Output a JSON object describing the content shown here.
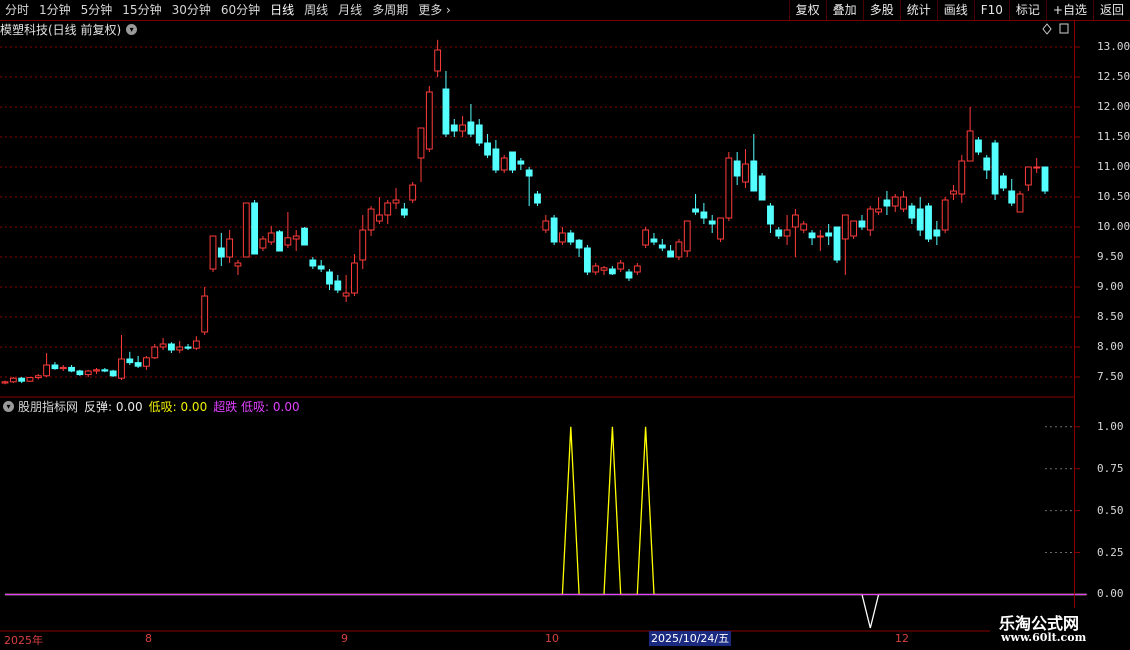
{
  "toolbar": {
    "periods": [
      "分时",
      "1分钟",
      "5分钟",
      "15分钟",
      "30分钟",
      "60分钟",
      "日线",
      "周线",
      "月线",
      "多周期",
      "更多"
    ],
    "active_period": "日线",
    "buttons": [
      "复权",
      "叠加",
      "多股",
      "统计",
      "画线",
      "F10",
      "标记",
      "+自选",
      "返回"
    ]
  },
  "stock": {
    "title": "模塑科技(日线 前复权)"
  },
  "indicator": {
    "name": "股朋指标网",
    "s1_label": "反弹:",
    "s1_value": "0.00",
    "s2_label": "低吸:",
    "s2_value": "0.00",
    "s3_label": "超跌 低吸:",
    "s3_value": "0.00"
  },
  "colors": {
    "up": "#ff3c3c",
    "down": "#54ffff",
    "grid": "#8a0000",
    "s1": "#ffffff",
    "s2": "#ffff00",
    "s3": "#e040ff"
  },
  "dates": {
    "year": "2025年",
    "m8": "8",
    "m9": "9",
    "m10": "10",
    "m12": "12",
    "selected": "2025/10/24/五"
  },
  "watermark": {
    "line1": "乐淘公式网",
    "line2": "www.60lt.com"
  },
  "chart_data": [
    {
      "type": "candlestick",
      "title": "",
      "ylim": [
        7.2,
        13.2
      ],
      "yticks": [
        "13.00",
        "12.50",
        "12.00",
        "11.50",
        "11.00",
        "10.50",
        "10.00",
        "9.50",
        "9.00",
        "8.50",
        "8.00",
        "7.50"
      ],
      "tickvalues": [
        13.0,
        12.5,
        12.0,
        11.5,
        11.0,
        10.5,
        10.0,
        9.5,
        9.0,
        8.5,
        8.0,
        7.5
      ],
      "ohlc": [
        [
          7.4,
          7.44,
          7.38,
          7.42
        ],
        [
          7.42,
          7.5,
          7.4,
          7.48
        ],
        [
          7.48,
          7.5,
          7.4,
          7.43
        ],
        [
          7.43,
          7.5,
          7.42,
          7.49
        ],
        [
          7.49,
          7.55,
          7.46,
          7.52
        ],
        [
          7.52,
          7.9,
          7.5,
          7.7
        ],
        [
          7.7,
          7.75,
          7.62,
          7.64
        ],
        [
          7.64,
          7.7,
          7.6,
          7.66
        ],
        [
          7.66,
          7.7,
          7.58,
          7.6
        ],
        [
          7.6,
          7.62,
          7.52,
          7.54
        ],
        [
          7.54,
          7.62,
          7.5,
          7.6
        ],
        [
          7.6,
          7.65,
          7.55,
          7.62
        ],
        [
          7.62,
          7.65,
          7.58,
          7.6
        ],
        [
          7.6,
          7.62,
          7.5,
          7.52
        ],
        [
          7.48,
          8.2,
          7.45,
          7.8
        ],
        [
          7.8,
          7.92,
          7.7,
          7.74
        ],
        [
          7.74,
          7.85,
          7.65,
          7.68
        ],
        [
          7.68,
          7.85,
          7.62,
          7.82
        ],
        [
          7.82,
          8.05,
          7.8,
          8.0
        ],
        [
          8.0,
          8.15,
          7.95,
          8.05
        ],
        [
          8.05,
          8.08,
          7.9,
          7.95
        ],
        [
          7.95,
          8.1,
          7.9,
          8.0
        ],
        [
          8.0,
          8.05,
          7.95,
          7.98
        ],
        [
          7.98,
          8.18,
          7.95,
          8.1
        ],
        [
          8.25,
          9.0,
          8.2,
          8.85
        ],
        [
          9.3,
          9.85,
          9.25,
          9.85
        ],
        [
          9.65,
          9.9,
          9.35,
          9.5
        ],
        [
          9.5,
          9.95,
          9.4,
          9.8
        ],
        [
          9.35,
          9.45,
          9.2,
          9.4
        ],
        [
          9.5,
          10.4,
          9.5,
          10.4
        ],
        [
          10.4,
          10.45,
          9.55,
          9.55
        ],
        [
          9.65,
          9.85,
          9.6,
          9.8
        ],
        [
          9.75,
          10.02,
          9.7,
          9.9
        ],
        [
          9.92,
          9.95,
          9.6,
          9.6
        ],
        [
          9.7,
          10.25,
          9.65,
          9.82
        ],
        [
          9.8,
          9.95,
          9.6,
          9.85
        ],
        [
          9.98,
          10.0,
          9.7,
          9.7
        ],
        [
          9.45,
          9.5,
          9.3,
          9.35
        ],
        [
          9.35,
          9.45,
          9.25,
          9.3
        ],
        [
          9.25,
          9.3,
          8.95,
          9.05
        ],
        [
          9.1,
          9.2,
          8.9,
          8.95
        ],
        [
          8.85,
          9.2,
          8.75,
          8.9
        ],
        [
          8.9,
          9.55,
          8.85,
          9.4
        ],
        [
          9.45,
          10.2,
          9.3,
          9.95
        ],
        [
          9.95,
          10.35,
          9.85,
          10.3
        ],
        [
          10.1,
          10.5,
          10.05,
          10.2
        ],
        [
          10.2,
          10.45,
          10.05,
          10.4
        ],
        [
          10.4,
          10.65,
          10.3,
          10.45
        ],
        [
          10.3,
          10.4,
          10.15,
          10.2
        ],
        [
          10.45,
          10.75,
          10.4,
          10.7
        ],
        [
          11.15,
          11.65,
          10.75,
          11.65
        ],
        [
          11.3,
          12.35,
          11.25,
          12.25
        ],
        [
          12.6,
          13.12,
          12.5,
          12.95
        ],
        [
          12.3,
          12.6,
          11.5,
          11.55
        ],
        [
          11.7,
          11.8,
          11.5,
          11.6
        ],
        [
          11.6,
          11.85,
          11.5,
          11.7
        ],
        [
          11.75,
          12.05,
          11.5,
          11.55
        ],
        [
          11.7,
          11.8,
          11.35,
          11.4
        ],
        [
          11.4,
          11.55,
          11.15,
          11.2
        ],
        [
          11.3,
          11.45,
          10.9,
          10.95
        ],
        [
          10.95,
          11.2,
          10.9,
          11.15
        ],
        [
          11.25,
          11.25,
          10.9,
          10.95
        ],
        [
          11.1,
          11.15,
          10.95,
          11.05
        ],
        [
          10.95,
          11.0,
          10.35,
          10.85
        ],
        [
          10.55,
          10.6,
          10.35,
          10.4
        ],
        [
          9.95,
          10.2,
          9.9,
          10.1
        ],
        [
          10.15,
          10.2,
          9.7,
          9.75
        ],
        [
          9.75,
          10.0,
          9.7,
          9.9
        ],
        [
          9.9,
          9.95,
          9.7,
          9.75
        ],
        [
          9.78,
          9.8,
          9.5,
          9.65
        ],
        [
          9.65,
          9.7,
          9.2,
          9.25
        ],
        [
          9.25,
          9.4,
          9.2,
          9.35
        ],
        [
          9.28,
          9.35,
          9.2,
          9.32
        ],
        [
          9.3,
          9.35,
          9.2,
          9.22
        ],
        [
          9.3,
          9.45,
          9.25,
          9.4
        ],
        [
          9.25,
          9.3,
          9.1,
          9.15
        ],
        [
          9.25,
          9.4,
          9.2,
          9.35
        ],
        [
          9.7,
          10.0,
          9.65,
          9.95
        ],
        [
          9.8,
          9.9,
          9.7,
          9.75
        ],
        [
          9.7,
          9.8,
          9.6,
          9.65
        ],
        [
          9.6,
          9.7,
          9.5,
          9.5
        ],
        [
          9.5,
          9.8,
          9.45,
          9.75
        ],
        [
          9.6,
          10.1,
          9.5,
          10.1
        ],
        [
          10.3,
          10.55,
          10.2,
          10.25
        ],
        [
          10.25,
          10.4,
          10.05,
          10.15
        ],
        [
          10.1,
          10.2,
          9.9,
          10.05
        ],
        [
          9.8,
          10.1,
          9.75,
          10.15
        ],
        [
          10.15,
          11.25,
          10.1,
          11.15
        ],
        [
          11.1,
          11.25,
          10.7,
          10.85
        ],
        [
          10.75,
          11.3,
          10.65,
          11.05
        ],
        [
          11.1,
          11.55,
          10.8,
          10.6
        ],
        [
          10.85,
          10.9,
          10.45,
          10.45
        ],
        [
          10.35,
          10.4,
          9.9,
          10.05
        ],
        [
          9.95,
          10.0,
          9.8,
          9.85
        ],
        [
          9.85,
          10.2,
          9.7,
          9.95
        ],
        [
          10.0,
          10.3,
          9.5,
          10.2
        ],
        [
          9.95,
          10.1,
          9.9,
          10.05
        ],
        [
          9.9,
          9.95,
          9.7,
          9.82
        ],
        [
          9.85,
          9.95,
          9.6,
          9.85
        ],
        [
          9.9,
          10.05,
          9.7,
          9.85
        ],
        [
          10.0,
          10.0,
          9.4,
          9.45
        ],
        [
          9.8,
          9.9,
          9.2,
          10.2
        ],
        [
          9.85,
          10.1,
          9.8,
          10.1
        ],
        [
          10.1,
          10.2,
          9.95,
          10.0
        ],
        [
          9.95,
          10.35,
          9.85,
          10.3
        ],
        [
          10.25,
          10.5,
          10.2,
          10.3
        ],
        [
          10.45,
          10.6,
          10.2,
          10.35
        ],
        [
          10.35,
          10.55,
          10.25,
          10.5
        ],
        [
          10.3,
          10.6,
          10.25,
          10.5
        ],
        [
          10.35,
          10.4,
          10.05,
          10.15
        ],
        [
          10.3,
          10.5,
          9.85,
          9.95
        ],
        [
          10.35,
          10.4,
          9.75,
          9.8
        ],
        [
          9.95,
          10.1,
          9.7,
          9.85
        ],
        [
          9.95,
          10.5,
          9.9,
          10.45
        ],
        [
          10.55,
          10.7,
          10.45,
          10.6
        ],
        [
          10.55,
          11.2,
          10.4,
          11.1
        ],
        [
          11.1,
          12.0,
          11.3,
          11.6
        ],
        [
          11.45,
          11.5,
          11.2,
          11.25
        ],
        [
          11.15,
          11.2,
          10.8,
          10.95
        ],
        [
          11.4,
          11.45,
          10.45,
          10.55
        ],
        [
          10.85,
          10.9,
          10.6,
          10.65
        ],
        [
          10.6,
          10.8,
          10.35,
          10.4
        ],
        [
          10.25,
          10.6,
          10.25,
          10.55
        ],
        [
          10.7,
          10.95,
          10.6,
          11.0
        ],
        [
          11.0,
          11.15,
          10.9,
          11.0
        ],
        [
          11.0,
          11.0,
          10.55,
          10.6
        ]
      ]
    },
    {
      "type": "line",
      "title": "",
      "ylim": [
        -0.2,
        1.1
      ],
      "yticks": [
        "1.00",
        "0.75",
        "0.50",
        "0.25",
        "0.00"
      ],
      "tickvalues": [
        1.0,
        0.75,
        0.5,
        0.25,
        0.0
      ],
      "series": [
        {
          "name": "反弹",
          "values": [
            0,
            0,
            0,
            0,
            0,
            0,
            0,
            0,
            0,
            0,
            0,
            0,
            0,
            0,
            0,
            0,
            0,
            0,
            0,
            0,
            0,
            0,
            0,
            0,
            0,
            0,
            0,
            0,
            0,
            0,
            0,
            0,
            0,
            0,
            0,
            0,
            0,
            0,
            0,
            0,
            0,
            0,
            0,
            0,
            0,
            0,
            0,
            0,
            0,
            0,
            0,
            0,
            0,
            0,
            0,
            0,
            0,
            0,
            0,
            0,
            0,
            0,
            0,
            0,
            0,
            0,
            0,
            0,
            0,
            0,
            0,
            0,
            0,
            0,
            0,
            0,
            0,
            0,
            0,
            0,
            0,
            0,
            0,
            0,
            0,
            0,
            0,
            0,
            0,
            0,
            0,
            0,
            0,
            0,
            0,
            0,
            0,
            0,
            0,
            0,
            0,
            0,
            0,
            0,
            -0.2,
            0,
            0,
            0,
            0,
            0,
            0,
            0,
            0,
            0,
            0,
            0,
            0,
            0,
            0,
            0,
            0,
            0,
            0,
            0,
            0,
            0,
            0,
            0,
            0,
            0,
            0
          ]
        },
        {
          "name": "低吸",
          "values": [
            0,
            0,
            0,
            0,
            0,
            0,
            0,
            0,
            0,
            0,
            0,
            0,
            0,
            0,
            0,
            0,
            0,
            0,
            0,
            0,
            0,
            0,
            0,
            0,
            0,
            0,
            0,
            0,
            0,
            0,
            0,
            0,
            0,
            0,
            0,
            0,
            0,
            0,
            0,
            0,
            0,
            0,
            0,
            0,
            0,
            0,
            0,
            0,
            0,
            0,
            0,
            0,
            0,
            0,
            0,
            0,
            0,
            0,
            0,
            0,
            0,
            0,
            0,
            0,
            0,
            0,
            0,
            0,
            1,
            0,
            0,
            0,
            0,
            1,
            0,
            0,
            0,
            1,
            0,
            0,
            0,
            0,
            0,
            0,
            0,
            0,
            0,
            0,
            0,
            0,
            0,
            0,
            0,
            0,
            0,
            0,
            0,
            0,
            0,
            0,
            0,
            0,
            0,
            0,
            0,
            0,
            0,
            0,
            0,
            0,
            0,
            0,
            0,
            0,
            0,
            0,
            0,
            0,
            0,
            0,
            0,
            0,
            0,
            0,
            0,
            0,
            0,
            0,
            0,
            0,
            0
          ]
        },
        {
          "name": "超跌 低吸",
          "values": [
            0,
            0,
            0,
            0,
            0,
            0,
            0,
            0,
            0,
            0,
            0,
            0,
            0,
            0,
            0,
            0,
            0,
            0,
            0,
            0,
            0,
            0,
            0,
            0,
            0,
            0,
            0,
            0,
            0,
            0,
            0,
            0,
            0,
            0,
            0,
            0,
            0,
            0,
            0,
            0,
            0,
            0,
            0,
            0,
            0,
            0,
            0,
            0,
            0,
            0,
            0,
            0,
            0,
            0,
            0,
            0,
            0,
            0,
            0,
            0,
            0,
            0,
            0,
            0,
            0,
            0,
            0,
            0,
            0,
            0,
            0,
            0,
            0,
            0,
            0,
            0,
            0,
            0,
            0,
            0,
            0,
            0,
            0,
            0,
            0,
            0,
            0,
            0,
            0,
            0,
            0,
            0,
            0,
            0,
            0,
            0,
            0,
            0,
            0,
            0,
            0,
            0,
            0,
            0,
            0,
            0,
            0,
            0,
            0,
            0,
            0,
            0,
            0,
            0,
            0,
            0,
            0,
            0,
            0,
            0,
            0,
            0,
            0,
            0,
            0,
            0,
            0,
            0,
            0,
            0,
            0
          ]
        }
      ]
    }
  ]
}
